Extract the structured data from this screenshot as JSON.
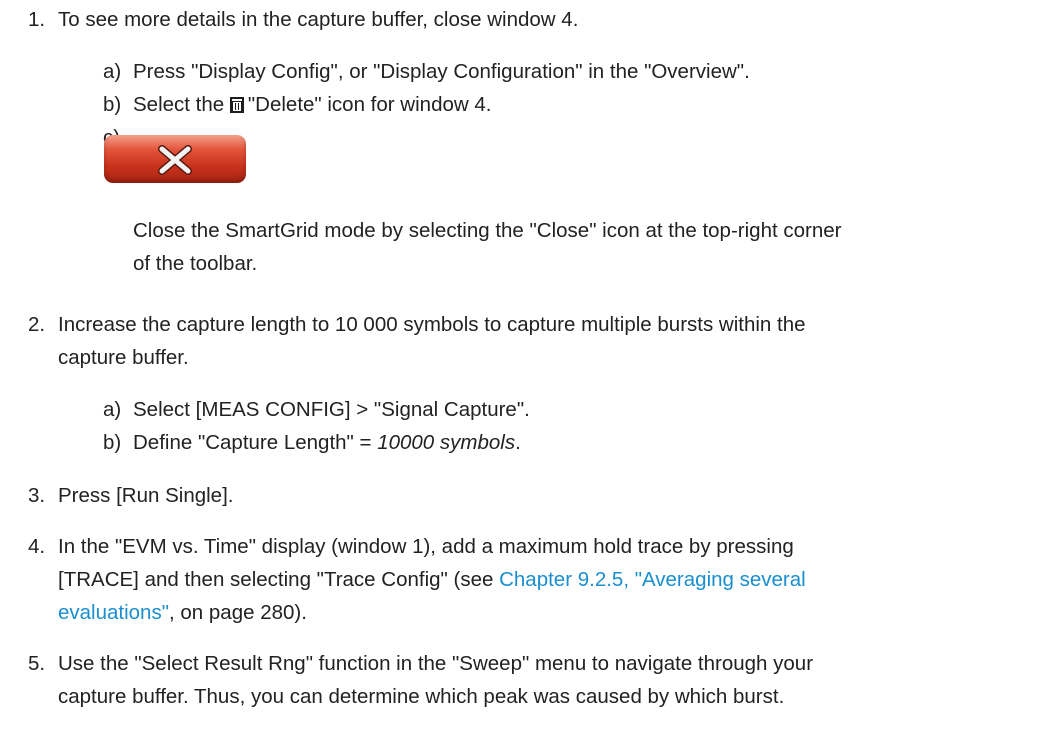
{
  "steps": [
    {
      "number": "1.",
      "text": "To see more details in the capture buffer, close window 4.",
      "substeps": [
        {
          "label": "a)",
          "text": "Press \"Display Config\", or \"Display Configuration\" in the \"Overview\"."
        },
        {
          "label": "b)",
          "pre": "Select the",
          "icon": "trash-icon",
          "post": "\"Delete\" icon for window 4."
        },
        {
          "label": "c)",
          "icon": "close-x-icon",
          "line1": "Close the SmartGrid mode by selecting the \"Close\" icon at the top-right corner",
          "line2": "of the toolbar."
        }
      ]
    },
    {
      "number": "2.",
      "line1": "Increase the capture length to 10 000 symbols to capture multiple bursts within the",
      "line2": "capture buffer.",
      "substeps": [
        {
          "label": "a)",
          "text": "Select [MEAS CONFIG] > \"Signal Capture\"."
        },
        {
          "label": "b)",
          "pre": "Define \"Capture Length\" = ",
          "emph": "10000 symbols",
          "post": "."
        }
      ]
    },
    {
      "number": "3.",
      "text": "Press [Run Single]."
    },
    {
      "number": "4.",
      "line1": "In the \"EVM vs. Time\" display (window 1), add a maximum hold trace by pressing",
      "line2_pre": "[TRACE] and then selecting \"Trace Config\" (see ",
      "link_part1": "Chapter 9.2.5, \"Averaging several",
      "link_part2": "evaluations\"",
      "line3_post": ", on page 280)."
    },
    {
      "number": "5.",
      "line1": "Use the \"Select Result Rng\" function in the \"Sweep\" menu to navigate through your",
      "line2": "capture buffer. Thus, you can determine which peak was caused by which burst."
    }
  ],
  "colors": {
    "text": "#222222",
    "link": "#1a8fd0",
    "close_button": "#c8321c"
  }
}
